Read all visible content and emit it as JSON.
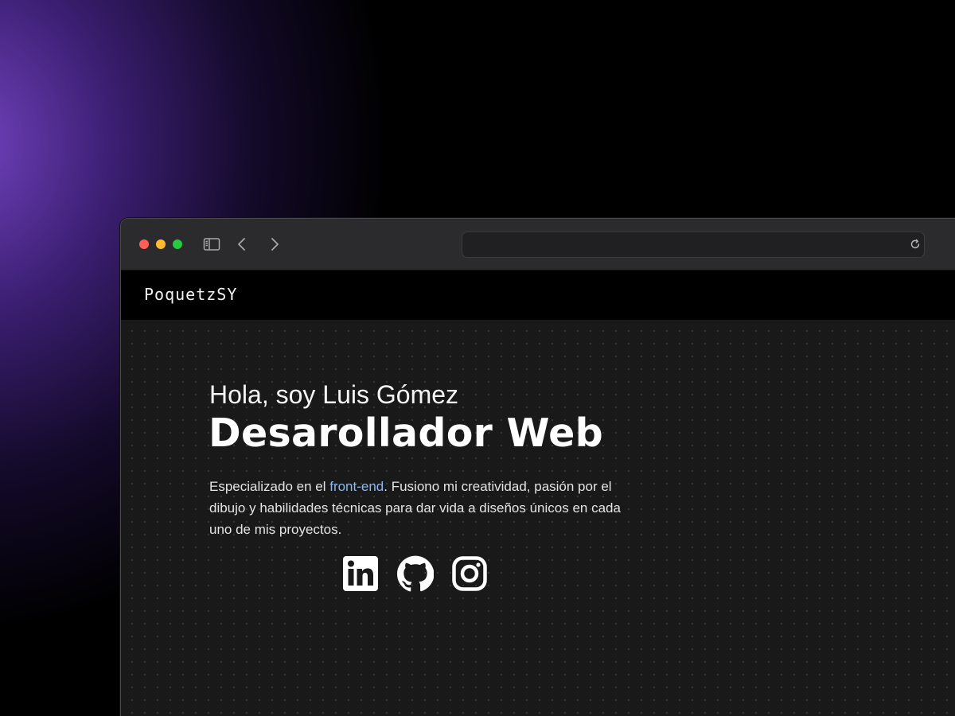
{
  "browser": {
    "url": "",
    "icons": [
      "sidebar-icon",
      "chevron-left-icon",
      "chevron-right-icon",
      "reload-icon"
    ]
  },
  "site": {
    "brand": "PoquetzSY",
    "hero": {
      "greeting": "Hola, soy Luis Gómez",
      "role": "Desarollador Web",
      "bio_before": "Especializado en el ",
      "bio_highlight": "front-end",
      "bio_after": ". Fusiono mi creatividad, pasión por el dibujo y habilidades técnicas para dar vida a diseños únicos en cada uno de mis proyectos."
    },
    "socials": [
      {
        "icon": "linkedin-icon"
      },
      {
        "icon": "github-icon"
      },
      {
        "icon": "instagram-icon"
      }
    ]
  },
  "colors": {
    "highlight": "#8fb7ea",
    "traffic_red": "#ff5f57",
    "traffic_yellow": "#febc2e",
    "traffic_green": "#28c840"
  }
}
